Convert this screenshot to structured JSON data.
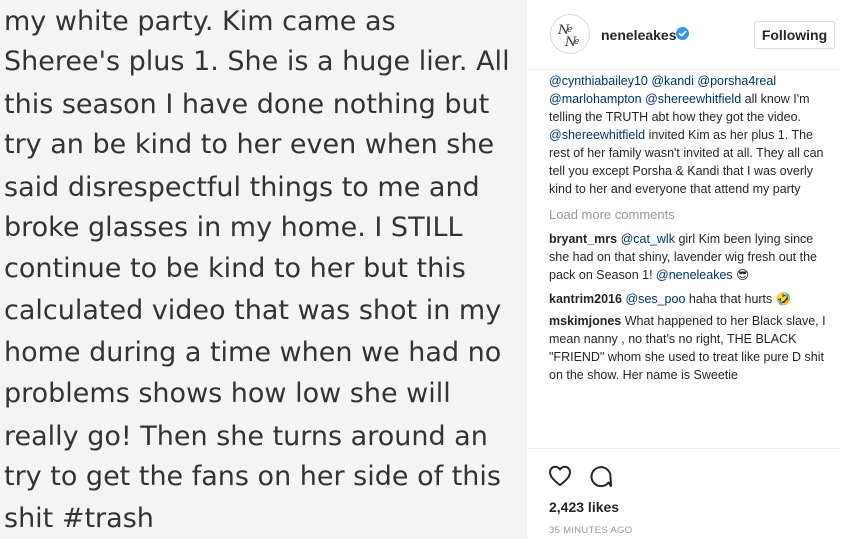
{
  "post_image": {
    "lines": [
      "my white party. Kim came as",
      "Sheree's plus 1. She is a huge lier. All",
      "this season I have done nothing but",
      "try an be kind to her even when she",
      "said disrespectful things to me and",
      "broke glasses in my home. I STILL",
      "continue to be kind to her but this",
      "calculated video that was shot in my",
      "home during a time when we had no",
      "problems shows how low she will",
      "really go! Then she turns around an",
      "try to get the fans on her side of this",
      "shit #trash"
    ]
  },
  "header": {
    "username": "neneleakes",
    "follow_label": "Following",
    "avatar_icon": "ne-ne-monogram-logo",
    "verified_icon": "verified-badge-icon"
  },
  "caption": {
    "m1": "@cynthiabailey10",
    "m2": "@kandi",
    "m3": "@porsha4real",
    "m4": "@marlohampton",
    "m5": "@shereewhitfield",
    "t1": "all know I'm telling the TRUTH abt how they got the video.",
    "m6": "@shereewhitfield",
    "t2": "invited Kim as her plus 1. The rest of her family wasn't invited at all. They all can tell you except Porsha & Kandi that I was overly kind to her and everyone that attend my party"
  },
  "load_more": "Load more comments",
  "comments": [
    {
      "user": "bryant_mrs",
      "mention": "@cat_wlk",
      "text": "girl Kim been lying since she had on that shiny, lavender wig fresh out the pack on Season 1!",
      "mention2": "@neneleakes",
      "emoji": "😎"
    },
    {
      "user": "kantrim2016",
      "mention": "@ses_poo",
      "text": "haha that hurts",
      "emoji": "🤣"
    },
    {
      "user": "mskimjones",
      "text": "What happened to her Black slave, I mean nanny , no that's no right, THE BLACK \"FRIEND\" whom she used to treat like pure D shit on the show. Her name is Sweetie"
    }
  ],
  "actions": {
    "like_icon": "heart-icon",
    "comment_icon": "comment-icon"
  },
  "likes": "2,423 likes",
  "timestamp": "35 MINUTES AGO",
  "colors": {
    "mention": "#003569",
    "text": "#262626",
    "muted": "#999999",
    "verified": "#3897f0",
    "image_bg": "#f4f4f4"
  }
}
